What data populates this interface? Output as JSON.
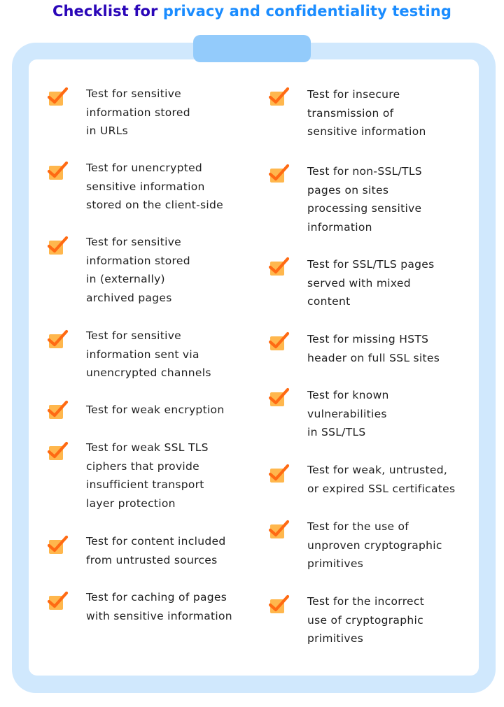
{
  "title": {
    "part1": "Checklist for",
    "part2": "privacy and confidentiality testing"
  },
  "colors": {
    "title_dark": "#2a06b8",
    "title_accent": "#1a8cff",
    "board": "#d0e8fd",
    "clip": "#93cbfb",
    "checkbox_fill": "#ffb74d",
    "checkmark": "#ff6a13"
  },
  "checklist": {
    "left": [
      {
        "label": "Test for sensitive\ninformation stored\nin URLs",
        "icon": "checked-box-icon"
      },
      {
        "label": "Test for unencrypted\nsensitive information\nstored on the client-side",
        "icon": "checked-box-icon"
      },
      {
        "label": "Test for sensitive\ninformation stored\nin (externally)\narchived pages",
        "icon": "checked-box-icon"
      },
      {
        "label": "Test for sensitive\ninformation sent via\nunencrypted channels",
        "icon": "checked-box-icon"
      },
      {
        "label": "Test for weak encryption",
        "icon": "checked-box-icon"
      },
      {
        "label": "Test for weak SSL TLS\nciphers that provide\ninsufficient transport\nlayer protection",
        "icon": "checked-box-icon"
      },
      {
        "label": "Test for content included\nfrom untrusted sources",
        "icon": "checked-box-icon"
      },
      {
        "label": "Test for caching of pages\nwith sensitive information",
        "icon": "checked-box-icon"
      }
    ],
    "right": [
      {
        "label": "Test for insecure\ntransmission of\nsensitive information",
        "icon": "checked-box-icon"
      },
      {
        "label": "Test for non-SSL/TLS\npages on sites\nprocessing sensitive\ninformation",
        "icon": "checked-box-icon"
      },
      {
        "label": "Test for SSL/TLS pages\nserved with mixed\ncontent",
        "icon": "checked-box-icon"
      },
      {
        "label": "Test for missing HSTS\nheader on full SSL sites",
        "icon": "checked-box-icon"
      },
      {
        "label": "Test for known\nvulnerabilities\nin SSL/TLS",
        "icon": "checked-box-icon"
      },
      {
        "label": "Test for weak, untrusted,\nor expired SSL certificates",
        "icon": "checked-box-icon"
      },
      {
        "label": "Test for the use of\nunproven cryptographic\nprimitives",
        "icon": "checked-box-icon"
      },
      {
        "label": "Test for the incorrect\nuse of cryptographic\nprimitives",
        "icon": "checked-box-icon"
      }
    ]
  }
}
